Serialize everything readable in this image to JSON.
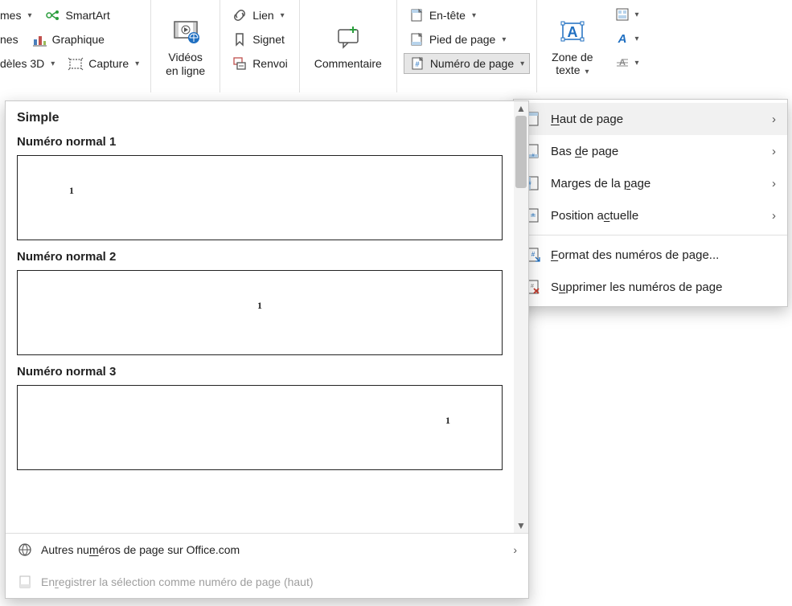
{
  "ribbon": {
    "illustrations": {
      "forms": "mes",
      "icons": "nes",
      "models3d": "dèles 3D",
      "smartart": "SmartArt",
      "chart": "Graphique",
      "capture": "Capture"
    },
    "media": {
      "videos_line1": "Vidéos",
      "videos_line2": "en ligne"
    },
    "links": {
      "link": "Lien",
      "bookmark": "Signet",
      "crossref": "Renvoi"
    },
    "comments": {
      "comment": "Commentaire"
    },
    "headerfooter": {
      "header": "En-tête",
      "footer": "Pied de page",
      "pagenum": "Numéro de page"
    },
    "text": {
      "textbox_line1": "Zone de",
      "textbox_line2": "texte"
    }
  },
  "submenu": {
    "top": "Haut de page",
    "bottom": "Bas de page",
    "margins": "Marges de la page",
    "current": "Position actuelle",
    "format": "Format des numéros de page...",
    "remove": "Supprimer les numéros de page"
  },
  "gallery": {
    "section": "Simple",
    "opt1": "Numéro normal 1",
    "opt2": "Numéro normal 2",
    "opt3": "Numéro normal 3",
    "sample": "1",
    "more": "Autres numéros de page sur Office.com",
    "save": "Enregistrer la sélection comme numéro de page (haut)"
  }
}
